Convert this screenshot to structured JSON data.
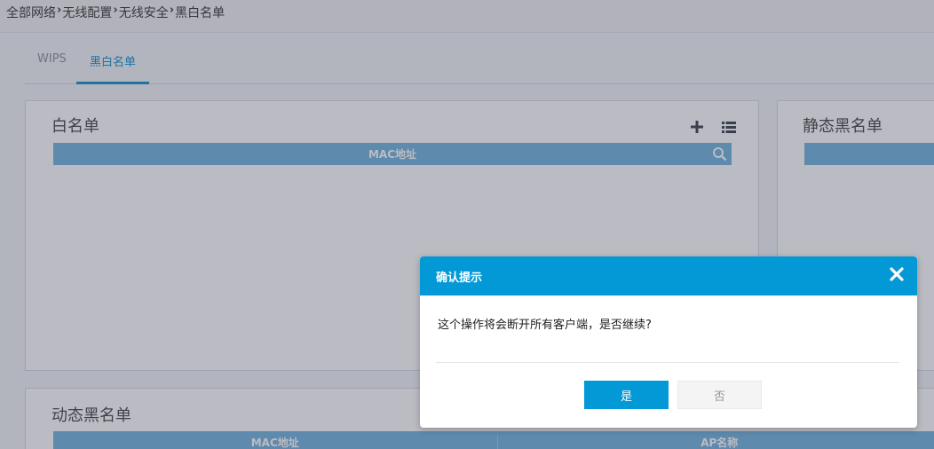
{
  "breadcrumb": [
    "全部网络",
    "无线配置",
    "无线安全",
    "黑白名单"
  ],
  "tabs": {
    "wips": "WIPS",
    "blackwhite": "黑白名单"
  },
  "whitelist": {
    "title": "白名单",
    "col_mac": "MAC地址"
  },
  "static_blacklist": {
    "title": "静态黑名单"
  },
  "dynamic_blacklist": {
    "title": "动态黑名单",
    "col_mac": "MAC地址",
    "col_ap": "AP名称"
  },
  "dialog": {
    "title": "确认提示",
    "message": "这个操作将会断开所有客户端，是否继续?",
    "yes": "是",
    "no": "否"
  },
  "colors": {
    "accent": "#0399d6",
    "table_header": "#6fb3dd"
  }
}
